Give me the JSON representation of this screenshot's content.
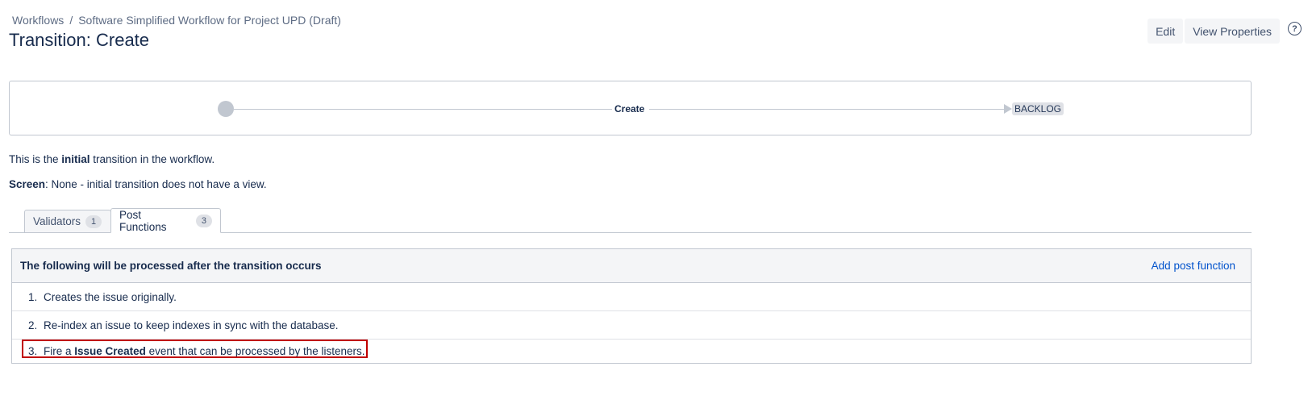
{
  "breadcrumbs": {
    "root": "Workflows",
    "separator": "/",
    "current": "Software Simplified Workflow for Project UPD (Draft)"
  },
  "page_title": "Transition: Create",
  "header_actions": {
    "edit_label": "Edit",
    "view_properties_label": "View Properties",
    "help_glyph": "?"
  },
  "diagram": {
    "transition_name": "Create",
    "target_status": "BACKLOG"
  },
  "info": {
    "line1_prefix": "This is the ",
    "line1_bold": "initial",
    "line1_suffix": " transition in the workflow.",
    "screen_label": "Screen",
    "screen_value": ": None - initial transition does not have a view."
  },
  "tabs": [
    {
      "label": "Validators",
      "count": "1",
      "active": false
    },
    {
      "label": "Post Functions",
      "count": "3",
      "active": true
    }
  ],
  "post_functions": {
    "heading": "The following will be processed after the transition occurs",
    "add_label": "Add post function",
    "items": [
      {
        "num": "1.",
        "text": "Creates the issue originally."
      },
      {
        "num": "2.",
        "text": "Re-index an issue to keep indexes in sync with the database."
      },
      {
        "num": "3.",
        "prefix": "Fire a ",
        "bold": "Issue Created",
        "suffix": " event that can be processed by the listeners."
      }
    ]
  },
  "colors": {
    "link": "#0052cc",
    "text": "#172b4d",
    "highlight_border": "#c00000"
  },
  "icons": {
    "help": "help-icon",
    "start_node": "start-node-circle",
    "arrow": "arrow-right-icon"
  }
}
